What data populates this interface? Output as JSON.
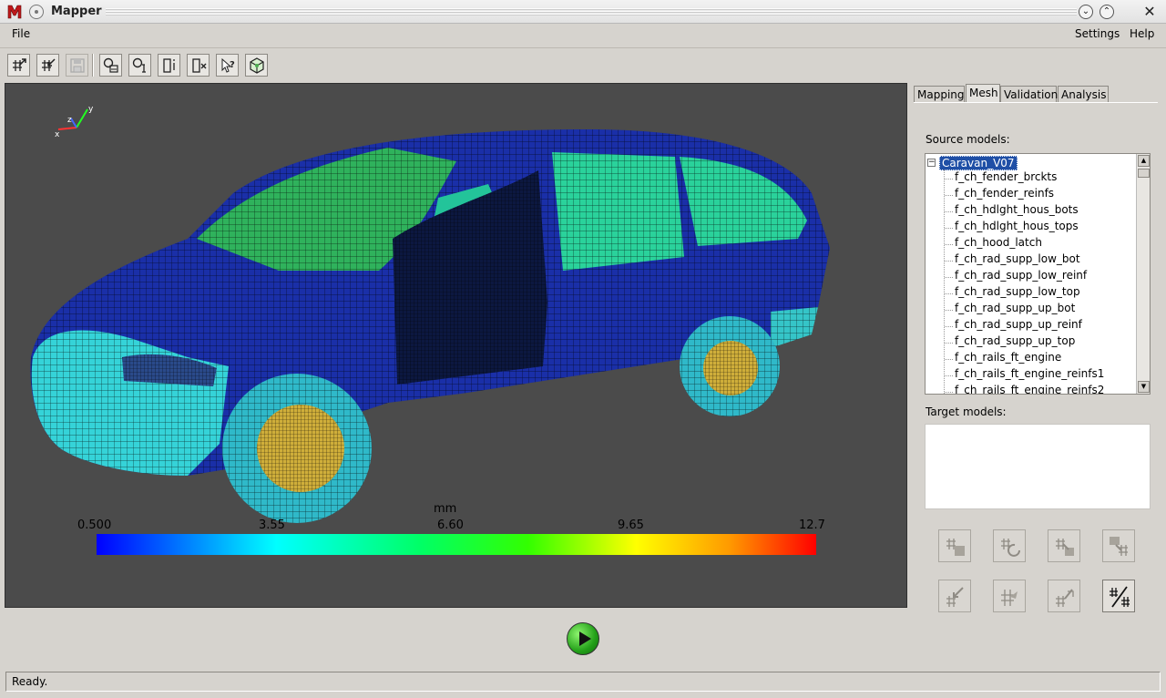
{
  "window": {
    "title": "Mapper"
  },
  "menubar": {
    "file": "File",
    "settings": "Settings",
    "help": "Help"
  },
  "toolbar": {
    "buttons": [
      "mesh-import-icon",
      "mesh-export-icon",
      "save-icon",
      "select-region-icon",
      "select-info-icon",
      "node-info-icon",
      "delete-element-icon",
      "pick-query-icon",
      "cube-view-icon"
    ],
    "disabled": [
      "save-icon"
    ]
  },
  "viewport": {
    "background": "#4b4b4b",
    "axis_labels": {
      "x": "x",
      "y": "y",
      "z": "z"
    },
    "colorbar": {
      "unit": "mm",
      "ticks": [
        "0.500",
        "3.55",
        "6.60",
        "9.65",
        "12.7"
      ],
      "min": 0.5,
      "max": 12.7
    }
  },
  "panel": {
    "tabs": {
      "mapping": "Mapping",
      "mesh": "Mesh",
      "validation": "Validation",
      "analysis": "Analysis"
    },
    "active_tab": "Mesh",
    "source_label": "Source models:",
    "target_label": "Target models:",
    "tree_root": "Caravan_V07",
    "tree_items": [
      "f_ch_fender_brckts",
      "f_ch_fender_reinfs",
      "f_ch_hdlght_hous_bots",
      "f_ch_hdlght_hous_tops",
      "f_ch_hood_latch",
      "f_ch_rad_supp_low_bot",
      "f_ch_rad_supp_low_reinf",
      "f_ch_rad_supp_low_top",
      "f_ch_rad_supp_up_bot",
      "f_ch_rad_supp_up_reinf",
      "f_ch_rad_supp_up_top",
      "f_ch_rails_ft_engine",
      "f_ch_rails_ft_engine_reinfs1",
      "f_ch_rails_ft_engine_reinfs2"
    ],
    "mesh_buttons": [
      "copy-mesh-icon",
      "refresh-mesh-icon",
      "map-mesh-icon",
      "transfer-mesh-icon",
      "import-target-icon",
      "pick-node-icon",
      "edit-mesh-icon",
      "split-mesh-icon"
    ]
  },
  "run": {
    "icon": "play-icon"
  },
  "status": {
    "text": "Ready."
  }
}
